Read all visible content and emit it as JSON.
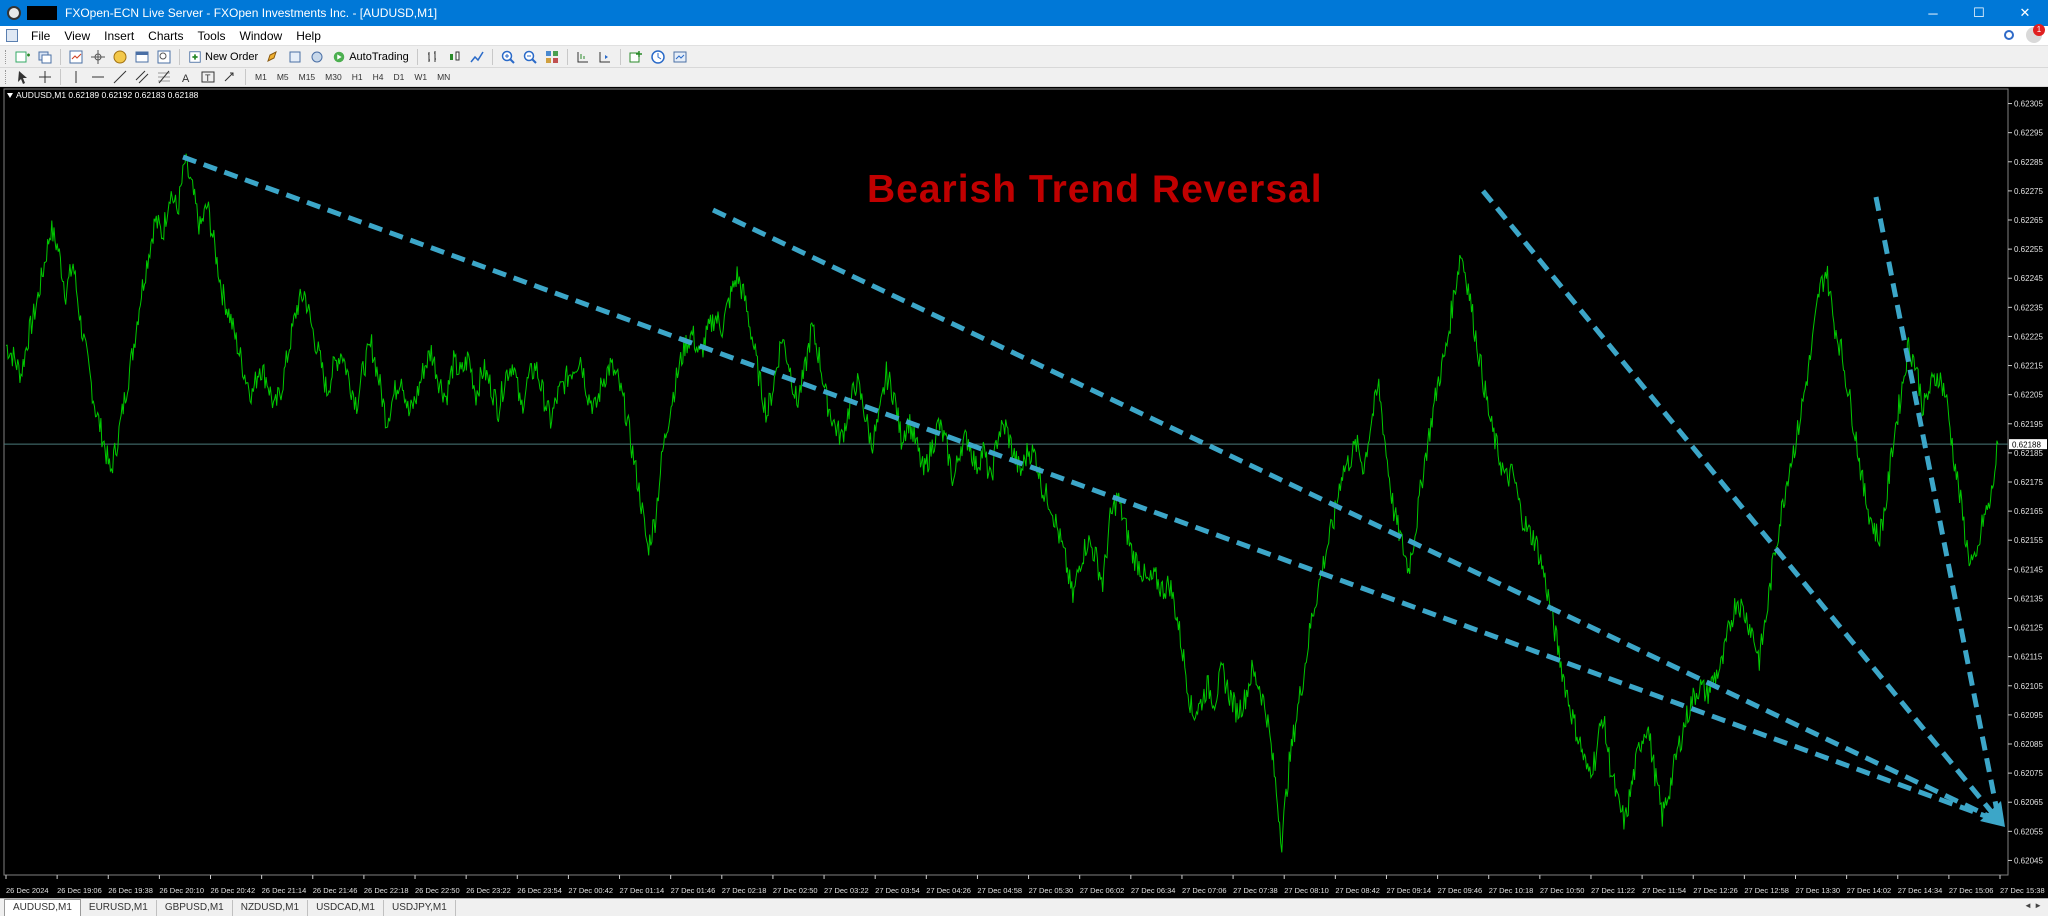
{
  "window": {
    "title": "FXOpen-ECN Live Server - FXOpen Investments Inc. - [AUDUSD,M1]",
    "buttons": [
      "─",
      "☐",
      "✕"
    ]
  },
  "menu": {
    "items": [
      "File",
      "View",
      "Insert",
      "Charts",
      "Tools",
      "Window",
      "Help"
    ],
    "notification_count": "1"
  },
  "toolbar": {
    "new_order_label": "New Order",
    "autotrading_label": "AutoTrading",
    "timeframes": [
      "M1",
      "M5",
      "M15",
      "M30",
      "H1",
      "H4",
      "D1",
      "W1",
      "MN"
    ]
  },
  "chart": {
    "info_line": "AUDUSD,M1  0.62189 0.62192 0.62183 0.62188",
    "headline": "Bearish Trend Reversal",
    "price_axis_labels": [
      "0.62305",
      "0.62295",
      "0.62285",
      "0.62275",
      "0.62265",
      "0.62255",
      "0.62245",
      "0.62235",
      "0.62225",
      "0.62215",
      "0.62205",
      "0.62195",
      "0.62185",
      "0.62175",
      "0.62165",
      "0.62155",
      "0.62145",
      "0.62135",
      "0.62125",
      "0.62115",
      "0.62105",
      "0.62095",
      "0.62085",
      "0.62075",
      "0.62065",
      "0.62055",
      "0.62045"
    ],
    "current_price": "0.62188",
    "time_axis_labels": [
      "26 Dec 2024",
      "26 Dec 19:06",
      "26 Dec 19:38",
      "26 Dec 20:10",
      "26 Dec 20:42",
      "26 Dec 21:14",
      "26 Dec 21:46",
      "26 Dec 22:18",
      "26 Dec 22:50",
      "26 Dec 23:22",
      "26 Dec 23:54",
      "27 Dec 00:42",
      "27 Dec 01:14",
      "27 Dec 01:46",
      "27 Dec 02:18",
      "27 Dec 02:50",
      "27 Dec 03:22",
      "27 Dec 03:54",
      "27 Dec 04:26",
      "27 Dec 04:58",
      "27 Dec 05:30",
      "27 Dec 06:02",
      "27 Dec 06:34",
      "27 Dec 07:06",
      "27 Dec 07:38",
      "27 Dec 08:10",
      "27 Dec 08:42",
      "27 Dec 09:14",
      "27 Dec 09:46",
      "27 Dec 10:18",
      "27 Dec 10:50",
      "27 Dec 11:22",
      "27 Dec 11:54",
      "27 Dec 12:26",
      "27 Dec 12:58",
      "27 Dec 13:30",
      "27 Dec 14:02",
      "27 Dec 14:34",
      "27 Dec 15:06",
      "27 Dec 15:38"
    ],
    "colors": {
      "background": "#000000",
      "price_line": "#00c800",
      "trend_arrows": "#3ca6c8",
      "headline": "#c00000",
      "bid_line": "#4a7a7a"
    },
    "price_range": [
      0.6204,
      0.6231
    ],
    "price_series": [
      0.62222,
      0.62218,
      0.62212,
      0.62225,
      0.62235,
      0.62248,
      0.62262,
      0.62255,
      0.6224,
      0.6225,
      0.6223,
      0.62215,
      0.622,
      0.6219,
      0.62178,
      0.6219,
      0.62205,
      0.6222,
      0.62238,
      0.62252,
      0.62265,
      0.6226,
      0.62275,
      0.62268,
      0.62285,
      0.62275,
      0.62262,
      0.6227,
      0.62255,
      0.6224,
      0.62232,
      0.62222,
      0.62212,
      0.62205,
      0.62215,
      0.6221,
      0.622,
      0.62208,
      0.62222,
      0.62235,
      0.6224,
      0.62228,
      0.62218,
      0.62206,
      0.62215,
      0.6222,
      0.6221,
      0.62202,
      0.62215,
      0.62222,
      0.6221,
      0.62196,
      0.62205,
      0.62212,
      0.62198,
      0.62204,
      0.62214,
      0.6222,
      0.6221,
      0.62204,
      0.62216,
      0.62212,
      0.62218,
      0.62205,
      0.62214,
      0.62208,
      0.622,
      0.62212,
      0.62216,
      0.622,
      0.6221,
      0.62215,
      0.62205,
      0.62196,
      0.62205,
      0.6221,
      0.62214,
      0.62218,
      0.62205,
      0.622,
      0.6221,
      0.62215,
      0.6221,
      0.622,
      0.62185,
      0.6217,
      0.62152,
      0.62162,
      0.62185,
      0.622,
      0.62212,
      0.62222,
      0.62226,
      0.62218,
      0.62226,
      0.62232,
      0.62228,
      0.62238,
      0.62246,
      0.62238,
      0.62225,
      0.6221,
      0.62198,
      0.6221,
      0.62225,
      0.62215,
      0.62202,
      0.62212,
      0.62228,
      0.62218,
      0.62203,
      0.62195,
      0.6219,
      0.622,
      0.6221,
      0.622,
      0.62188,
      0.62196,
      0.62212,
      0.62205,
      0.6219,
      0.62196,
      0.62188,
      0.62178,
      0.62186,
      0.62195,
      0.62188,
      0.62175,
      0.62188,
      0.6219,
      0.6218,
      0.62186,
      0.62175,
      0.62192,
      0.62194,
      0.62185,
      0.62178,
      0.62186,
      0.62184,
      0.62172,
      0.62168,
      0.62158,
      0.62148,
      0.62135,
      0.62148,
      0.62155,
      0.6215,
      0.6214,
      0.62162,
      0.6217,
      0.6216,
      0.6215,
      0.62146,
      0.6214,
      0.62142,
      0.62138,
      0.6214,
      0.62128,
      0.62112,
      0.62095,
      0.62098,
      0.62105,
      0.621,
      0.6211,
      0.62102,
      0.62096,
      0.621,
      0.6211,
      0.62105,
      0.62095,
      0.62075,
      0.62052,
      0.62078,
      0.62095,
      0.6211,
      0.62128,
      0.6214,
      0.62152,
      0.62162,
      0.62178,
      0.62182,
      0.62188,
      0.6218,
      0.62196,
      0.62208,
      0.62185,
      0.62165,
      0.62155,
      0.62145,
      0.6216,
      0.6218,
      0.62195,
      0.6221,
      0.6222,
      0.62238,
      0.62254,
      0.62242,
      0.62225,
      0.6221,
      0.62195,
      0.62185,
      0.62176,
      0.62178,
      0.62165,
      0.62158,
      0.62155,
      0.62145,
      0.62132,
      0.62118,
      0.62105,
      0.62094,
      0.62085,
      0.62075,
      0.6208,
      0.62095,
      0.62078,
      0.62065,
      0.62058,
      0.62072,
      0.62085,
      0.62092,
      0.62075,
      0.6206,
      0.6207,
      0.62082,
      0.62092,
      0.621,
      0.62105,
      0.62102,
      0.62108,
      0.62112,
      0.62125,
      0.62135,
      0.6213,
      0.62124,
      0.62114,
      0.6213,
      0.6215,
      0.62165,
      0.6218,
      0.6219,
      0.62205,
      0.6222,
      0.6224,
      0.62248,
      0.6223,
      0.6222,
      0.62205,
      0.6219,
      0.62172,
      0.62162,
      0.62155,
      0.62168,
      0.6219,
      0.62205,
      0.62222,
      0.62215,
      0.622,
      0.62208,
      0.62212,
      0.62205,
      0.62185,
      0.62168,
      0.6215,
      0.62146,
      0.62162,
      0.62168,
      0.62188
    ]
  },
  "tabs": [
    "AUDUSD,M1",
    "EURUSD,M1",
    "GBPUSD,M1",
    "NZDUSD,M1",
    "USDCAD,M1",
    "USDJPY,M1"
  ]
}
